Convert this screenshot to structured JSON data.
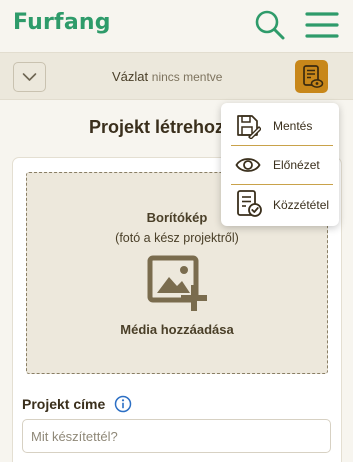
{
  "header": {
    "logo": "Furfang",
    "search_icon": "search-icon",
    "menu_icon": "hamburger-menu-icon"
  },
  "status": {
    "main": "Vázlat",
    "sub": "nincs mentve",
    "accent": "#c8871a"
  },
  "page": {
    "title": "Projekt létrehozása"
  },
  "cover": {
    "title": "Borítókép",
    "subtitle": "(fotó a kész projektről)",
    "action": "Média hozzáadása"
  },
  "form": {
    "project_title_label": "Projekt címe",
    "project_title_placeholder": "Mit készítettél?",
    "project_title_value": ""
  },
  "menu": {
    "items": [
      {
        "label": "Mentés",
        "icon": "save-icon"
      },
      {
        "label": "Előnézet",
        "icon": "eye-icon"
      },
      {
        "label": "Közzététel",
        "icon": "publish-icon"
      }
    ]
  },
  "colors": {
    "brand": "#2e9b6a",
    "accent": "#c8871a",
    "text": "#3a2f1c"
  }
}
